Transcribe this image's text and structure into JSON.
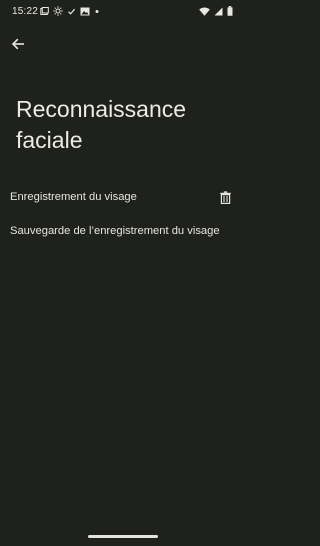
{
  "status_bar": {
    "time": "15:22"
  },
  "header": {
    "back_icon": "arrow-left-icon"
  },
  "page": {
    "title": "Reconnaissance faciale"
  },
  "items": [
    {
      "label": "Enregistrement du visage",
      "action_icon": "trash-icon"
    },
    {
      "label": "Sauvegarde de l’enregistrement du visage"
    }
  ],
  "colors": {
    "background": "#1f211c",
    "text": "#e6e6de"
  }
}
